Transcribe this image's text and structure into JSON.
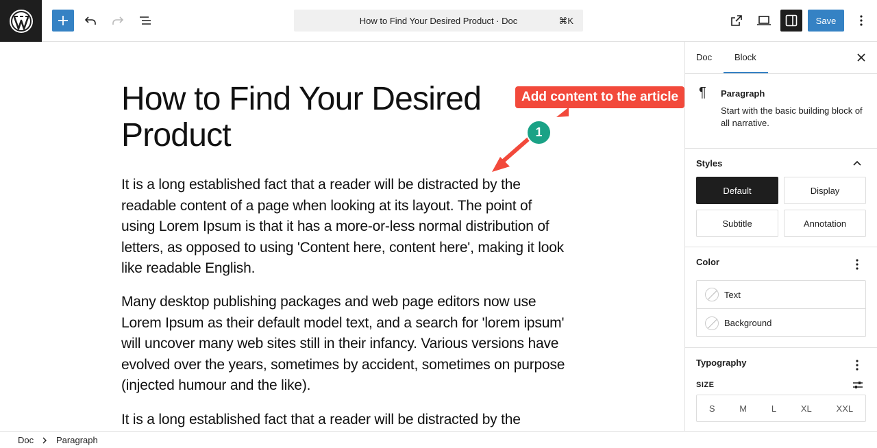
{
  "topbar": {
    "document_title": "How to Find Your Desired Product · Doc",
    "shortcut": "⌘K",
    "save_label": "Save"
  },
  "post": {
    "title": "How to Find Your Desired Product",
    "paragraphs": [
      "It is a long established fact that a reader will be distracted by the readable content of a page when looking at its layout. The point of using Lorem Ipsum is that it has a more-or-less normal distribution of letters, as opposed to using 'Content here, content here', making it look like readable English.",
      "Many desktop publishing packages and web page editors now use Lorem Ipsum as their default model text, and a search for 'lorem ipsum' will uncover many web sites still in their infancy. Various versions have evolved over the years, sometimes by accident, sometimes on purpose (injected humour and the like).",
      "It is a long established fact that a reader will be distracted by the"
    ]
  },
  "annotation": {
    "callout": "Add content to the article",
    "step_number": "1",
    "color": "#f2493b"
  },
  "sidebar": {
    "tabs": [
      "Doc",
      "Block"
    ],
    "active_tab": "Block",
    "block": {
      "name": "Paragraph",
      "description": "Start with the basic building block of all narrative."
    },
    "styles": {
      "title": "Styles",
      "options": [
        "Default",
        "Display",
        "Subtitle",
        "Annotation"
      ],
      "active": "Default"
    },
    "color": {
      "title": "Color",
      "items": [
        "Text",
        "Background"
      ]
    },
    "typography": {
      "title": "Typography",
      "size_label": "SIZE",
      "sizes": [
        "S",
        "M",
        "L",
        "XL",
        "XXL"
      ]
    }
  },
  "footer": {
    "breadcrumbs": [
      "Doc",
      "Paragraph"
    ]
  },
  "colors": {
    "accent": "#3582c4",
    "step_badge": "#1aa286"
  }
}
